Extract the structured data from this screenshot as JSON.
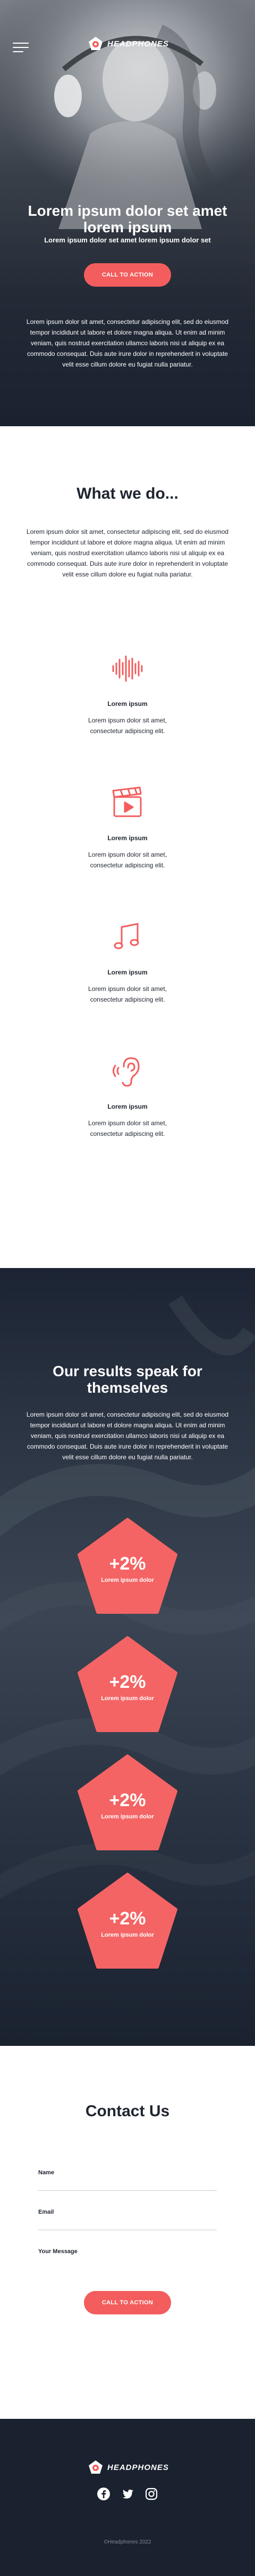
{
  "header": {
    "menu_icon": "hamburger-menu-icon",
    "logo_text": "HEADPHONES"
  },
  "hero": {
    "title": "Lorem ipsum dolor set amet lorem ipsum",
    "subtitle": "Lorem ipsum dolor set amet lorem ipsum dolor set",
    "cta_label": "CALL TO ACTION",
    "body": "Lorem ipsum dolor sit amet, consectetur adipiscing elit, sed do eiusmod tempor incididunt ut labore et dolore magna aliqua. Ut enim ad minim veniam, quis nostrud exercitation ullamco laboris nisi ut aliquip ex ea commodo consequat. Duis aute irure dolor in reprehenderit in voluptate velit esse cillum dolore eu fugiat nulla pariatur."
  },
  "what_we_do": {
    "title": "What we do...",
    "body": "Lorem ipsum dolor sit amet, consectetur adipiscing elit, sed do eiusmod tempor incididunt ut labore et dolore magna aliqua. Ut enim ad minim veniam, quis nostrud exercitation ullamco laboris nisi ut aliquip ex ea commodo consequat. Duis aute irure dolor in reprehenderit in voluptate velit esse cillum dolore eu fugiat nulla pariatur.",
    "services": [
      {
        "icon": "sound-wave-icon",
        "title": "Lorem ipsum",
        "text": "Lorem ipsum dolor sit amet, consectetur adipiscing elit."
      },
      {
        "icon": "clapperboard-icon",
        "title": "Lorem ipsum",
        "text": "Lorem ipsum dolor sit amet, consectetur adipiscing elit."
      },
      {
        "icon": "music-note-icon",
        "title": "Lorem ipsum",
        "text": "Lorem ipsum dolor sit amet, consectetur adipiscing elit."
      },
      {
        "icon": "ear-icon",
        "title": "Lorem ipsum",
        "text": "Lorem ipsum dolor sit amet, consectetur adipiscing elit."
      }
    ]
  },
  "results": {
    "title": "Our results speak for themselves",
    "body": "Lorem ipsum dolor sit amet, consectetur adipiscing elit, sed do eiusmod tempor incididunt ut labore et dolore magna aliqua. Ut enim ad minim veniam, quis nostrud exercitation ullamco laboris nisi ut aliquip ex ea commodo consequat. Duis aute irure dolor in reprehenderit in voluptate velit esse cillum dolore eu fugiat nulla pariatur.",
    "stats": [
      {
        "value": "+2%",
        "label": "Lorem ipsum dolor"
      },
      {
        "value": "+2%",
        "label": "Lorem ipsum dolor"
      },
      {
        "value": "+2%",
        "label": "Lorem ipsum dolor"
      },
      {
        "value": "+2%",
        "label": "Lorem ipsum dolor"
      }
    ]
  },
  "contact": {
    "title": "Contact Us",
    "name_label": "Name",
    "email_label": "Email",
    "message_label": "Your Message",
    "cta_label": "CALL TO ACTION"
  },
  "footer": {
    "logo_text": "HEADPHONES",
    "socials": [
      "facebook-icon",
      "twitter-icon",
      "instagram-icon"
    ],
    "copyright": "©Headphones 2022"
  },
  "colors": {
    "accent": "#f45d5d",
    "dark": "#1a2230",
    "text": "#1f2530"
  }
}
